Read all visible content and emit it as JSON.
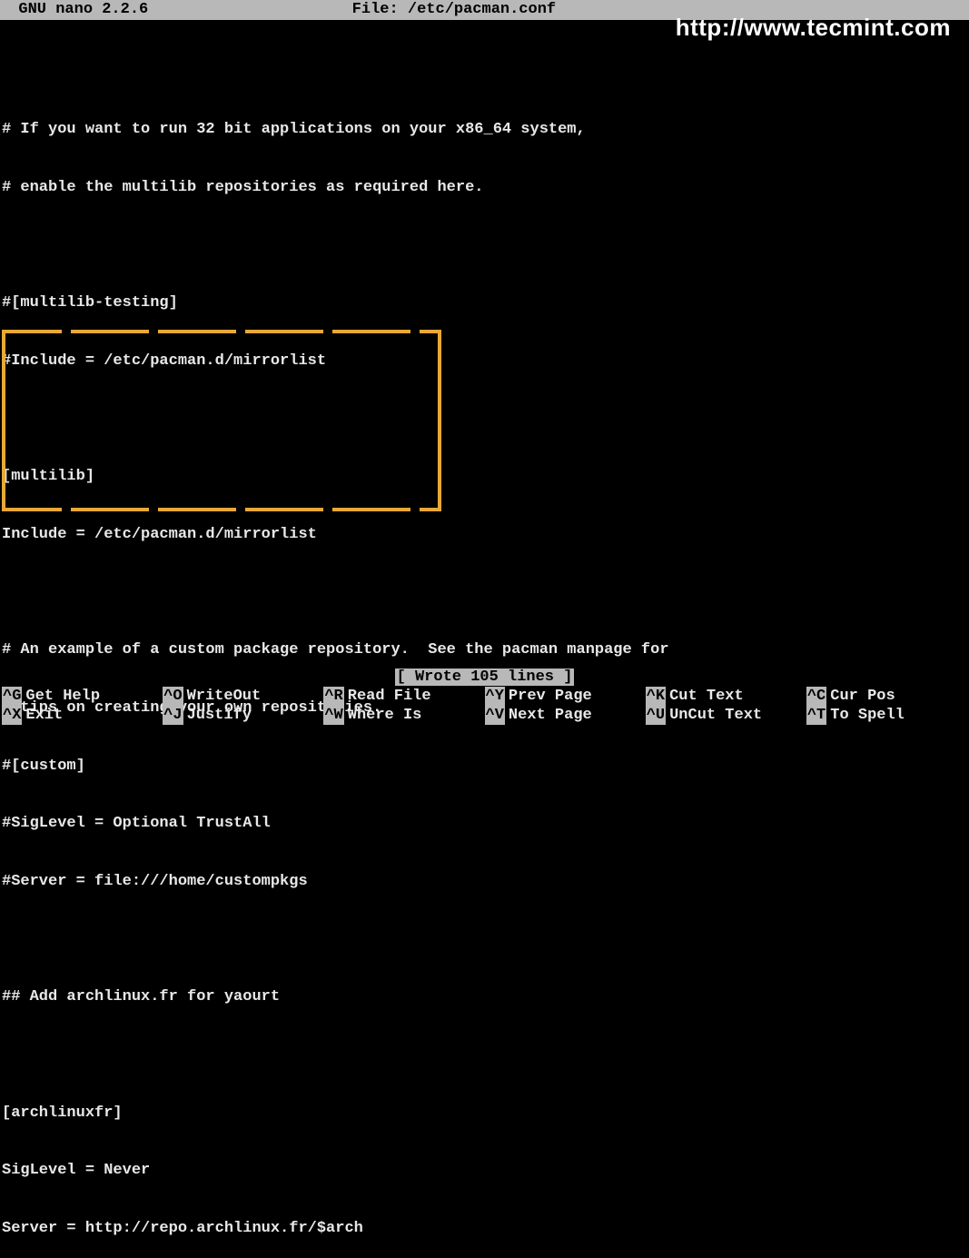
{
  "title_bar": {
    "app": "  GNU nano 2.2.6",
    "file_label": "File: /etc/pacman.conf"
  },
  "watermark": "http://www.tecmint.com",
  "content_lines": [
    "",
    "# If you want to run 32 bit applications on your x86_64 system,",
    "# enable the multilib repositories as required here.",
    "",
    "#[multilib-testing]",
    "#Include = /etc/pacman.d/mirrorlist",
    "",
    "[multilib]",
    "Include = /etc/pacman.d/mirrorlist",
    "",
    "# An example of a custom package repository.  See the pacman manpage for",
    "# tips on creating your own repositories.",
    "#[custom]",
    "#SigLevel = Optional TrustAll",
    "#Server = file:///home/custompkgs",
    "",
    "## Add archlinux.fr for yaourt",
    "",
    "[archlinuxfr]",
    "SigLevel = Never",
    "Server = http://repo.archlinux.fr/$arch"
  ],
  "status": "[ Wrote 105 lines ]",
  "shortcuts": {
    "row1": [
      {
        "key": "^G",
        "label": "Get Help"
      },
      {
        "key": "^O",
        "label": "WriteOut"
      },
      {
        "key": "^R",
        "label": "Read File"
      },
      {
        "key": "^Y",
        "label": "Prev Page"
      },
      {
        "key": "^K",
        "label": "Cut Text"
      },
      {
        "key": "^C",
        "label": "Cur Pos"
      }
    ],
    "row2": [
      {
        "key": "^X",
        "label": "Exit"
      },
      {
        "key": "^J",
        "label": "Justify"
      },
      {
        "key": "^W",
        "label": "Where Is"
      },
      {
        "key": "^V",
        "label": "Next Page"
      },
      {
        "key": "^U",
        "label": "UnCut Text"
      },
      {
        "key": "^T",
        "label": "To Spell"
      }
    ]
  }
}
